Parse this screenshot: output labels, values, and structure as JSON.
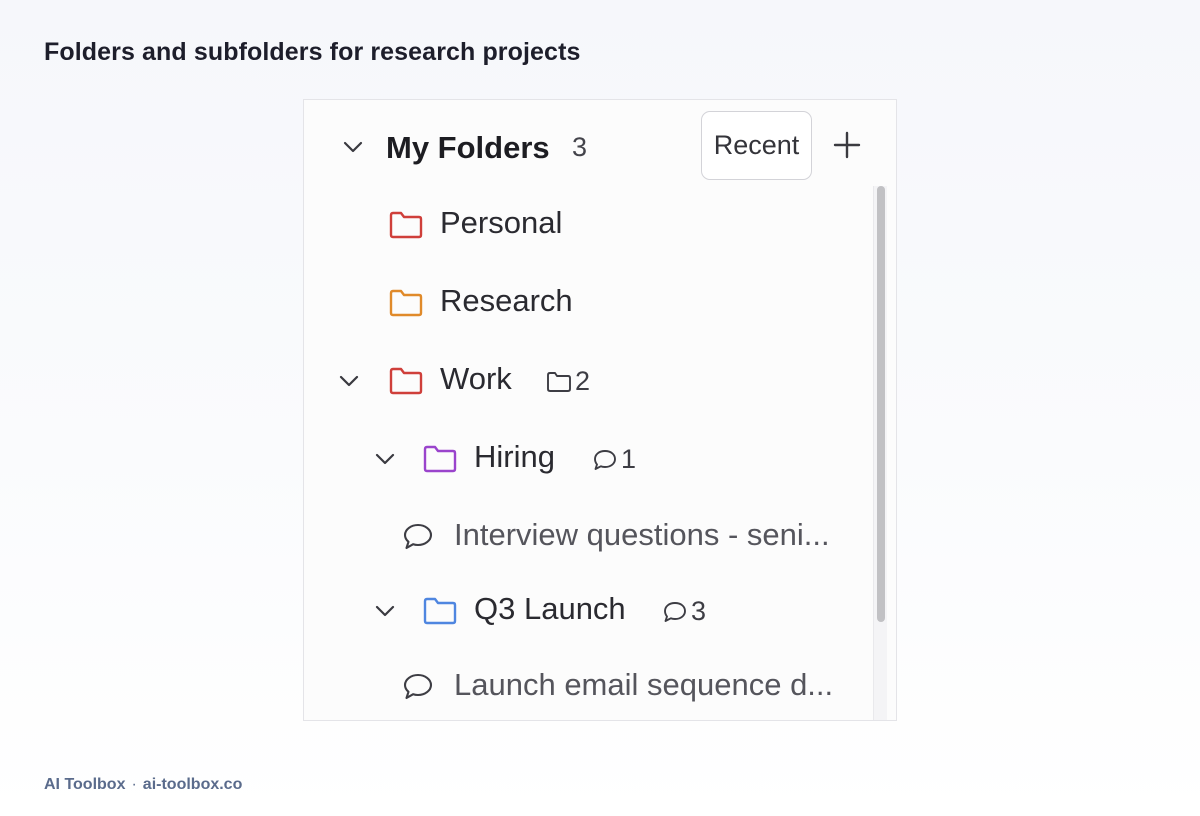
{
  "page": {
    "title": "Folders and subfolders for research projects"
  },
  "panel": {
    "header": {
      "title": "My Folders",
      "count": "3",
      "recent_label": "Recent",
      "add_icon": "plus-icon"
    },
    "items": [
      {
        "label": "Personal",
        "type": "folder",
        "color": "#cf3f3a",
        "icon": "folder-icon"
      },
      {
        "label": "Research",
        "type": "folder",
        "color": "#e08a2a",
        "icon": "folder-icon"
      },
      {
        "label": "Work",
        "type": "folder",
        "color": "#cf3f3a",
        "icon": "folder-icon",
        "expanded": true,
        "subfolder_count": "2"
      },
      {
        "label": "Hiring",
        "type": "folder",
        "color": "#9a44cc",
        "icon": "folder-icon",
        "expanded": true,
        "chat_count": "1"
      },
      {
        "label": "Interview questions - seni...",
        "type": "chat",
        "icon": "chat-bubble-icon"
      },
      {
        "label": "Q3 Launch",
        "type": "folder",
        "color": "#4f86e0",
        "icon": "folder-icon",
        "expanded": true,
        "chat_count": "3"
      },
      {
        "label": "Launch email sequence d...",
        "type": "chat",
        "icon": "chat-bubble-icon"
      }
    ]
  },
  "footer": {
    "brand": "AI Toolbox",
    "separator": "·",
    "url": "ai-toolbox.co"
  }
}
